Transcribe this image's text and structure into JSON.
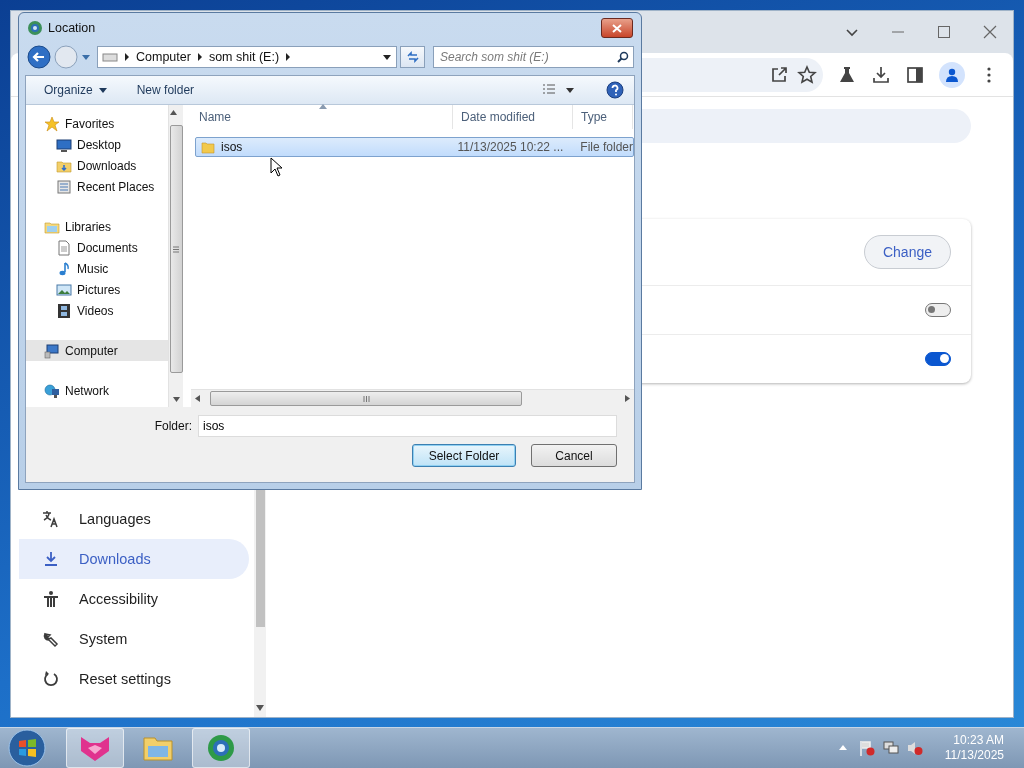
{
  "browser": {
    "settings_card": {
      "rows": [
        {
          "kind": "button",
          "label": "Change"
        },
        {
          "kind": "toggle",
          "on": false
        },
        {
          "kind": "toggle",
          "on": true
        }
      ]
    },
    "sidebar": {
      "items": [
        {
          "kind": "languages",
          "label": "Languages",
          "selected": false
        },
        {
          "kind": "downloads",
          "label": "Downloads",
          "selected": true
        },
        {
          "kind": "accessibility",
          "label": "Accessibility",
          "selected": false
        },
        {
          "kind": "system",
          "label": "System",
          "selected": false
        },
        {
          "kind": "reset",
          "label": "Reset settings",
          "selected": false
        }
      ]
    }
  },
  "dialog": {
    "title": "Location",
    "breadcrumb": [
      "Computer",
      "som shit (E:)"
    ],
    "search": {
      "placeholder": "Search som shit (E:)"
    },
    "toolbar": [
      {
        "kind": "menu",
        "label": "Organize"
      },
      {
        "kind": "button",
        "label": "New folder"
      }
    ],
    "nav_pane": [
      {
        "kind": "favorites",
        "label": "Favorites",
        "selected": false,
        "children": [
          {
            "kind": "desktop",
            "label": "Desktop",
            "selected": false
          },
          {
            "kind": "downloads",
            "label": "Downloads",
            "selected": false
          },
          {
            "kind": "recent",
            "label": "Recent Places",
            "selected": false
          }
        ]
      },
      {
        "kind": "libraries",
        "label": "Libraries",
        "selected": false,
        "children": [
          {
            "kind": "documents",
            "label": "Documents",
            "selected": false
          },
          {
            "kind": "music",
            "label": "Music",
            "selected": false
          },
          {
            "kind": "pictures",
            "label": "Pictures",
            "selected": false
          },
          {
            "kind": "videos",
            "label": "Videos",
            "selected": false
          }
        ]
      },
      {
        "kind": "computer",
        "label": "Computer",
        "selected": true
      },
      {
        "kind": "network",
        "label": "Network",
        "selected": false
      }
    ],
    "columns": [
      "Name",
      "Date modified",
      "Type"
    ],
    "rows": [
      {
        "name": "isos",
        "date": "11/13/2025 10:22 ...",
        "type": "File folder",
        "selected": true
      }
    ],
    "folder": {
      "label": "Folder:",
      "value": "isos"
    },
    "buttons": [
      {
        "kind": "default",
        "label": "Select Folder"
      },
      {
        "kind": "normal",
        "label": "Cancel"
      }
    ]
  },
  "taskbar": {
    "clock": {
      "time": "10:23 AM",
      "date": "11/13/2025"
    }
  }
}
